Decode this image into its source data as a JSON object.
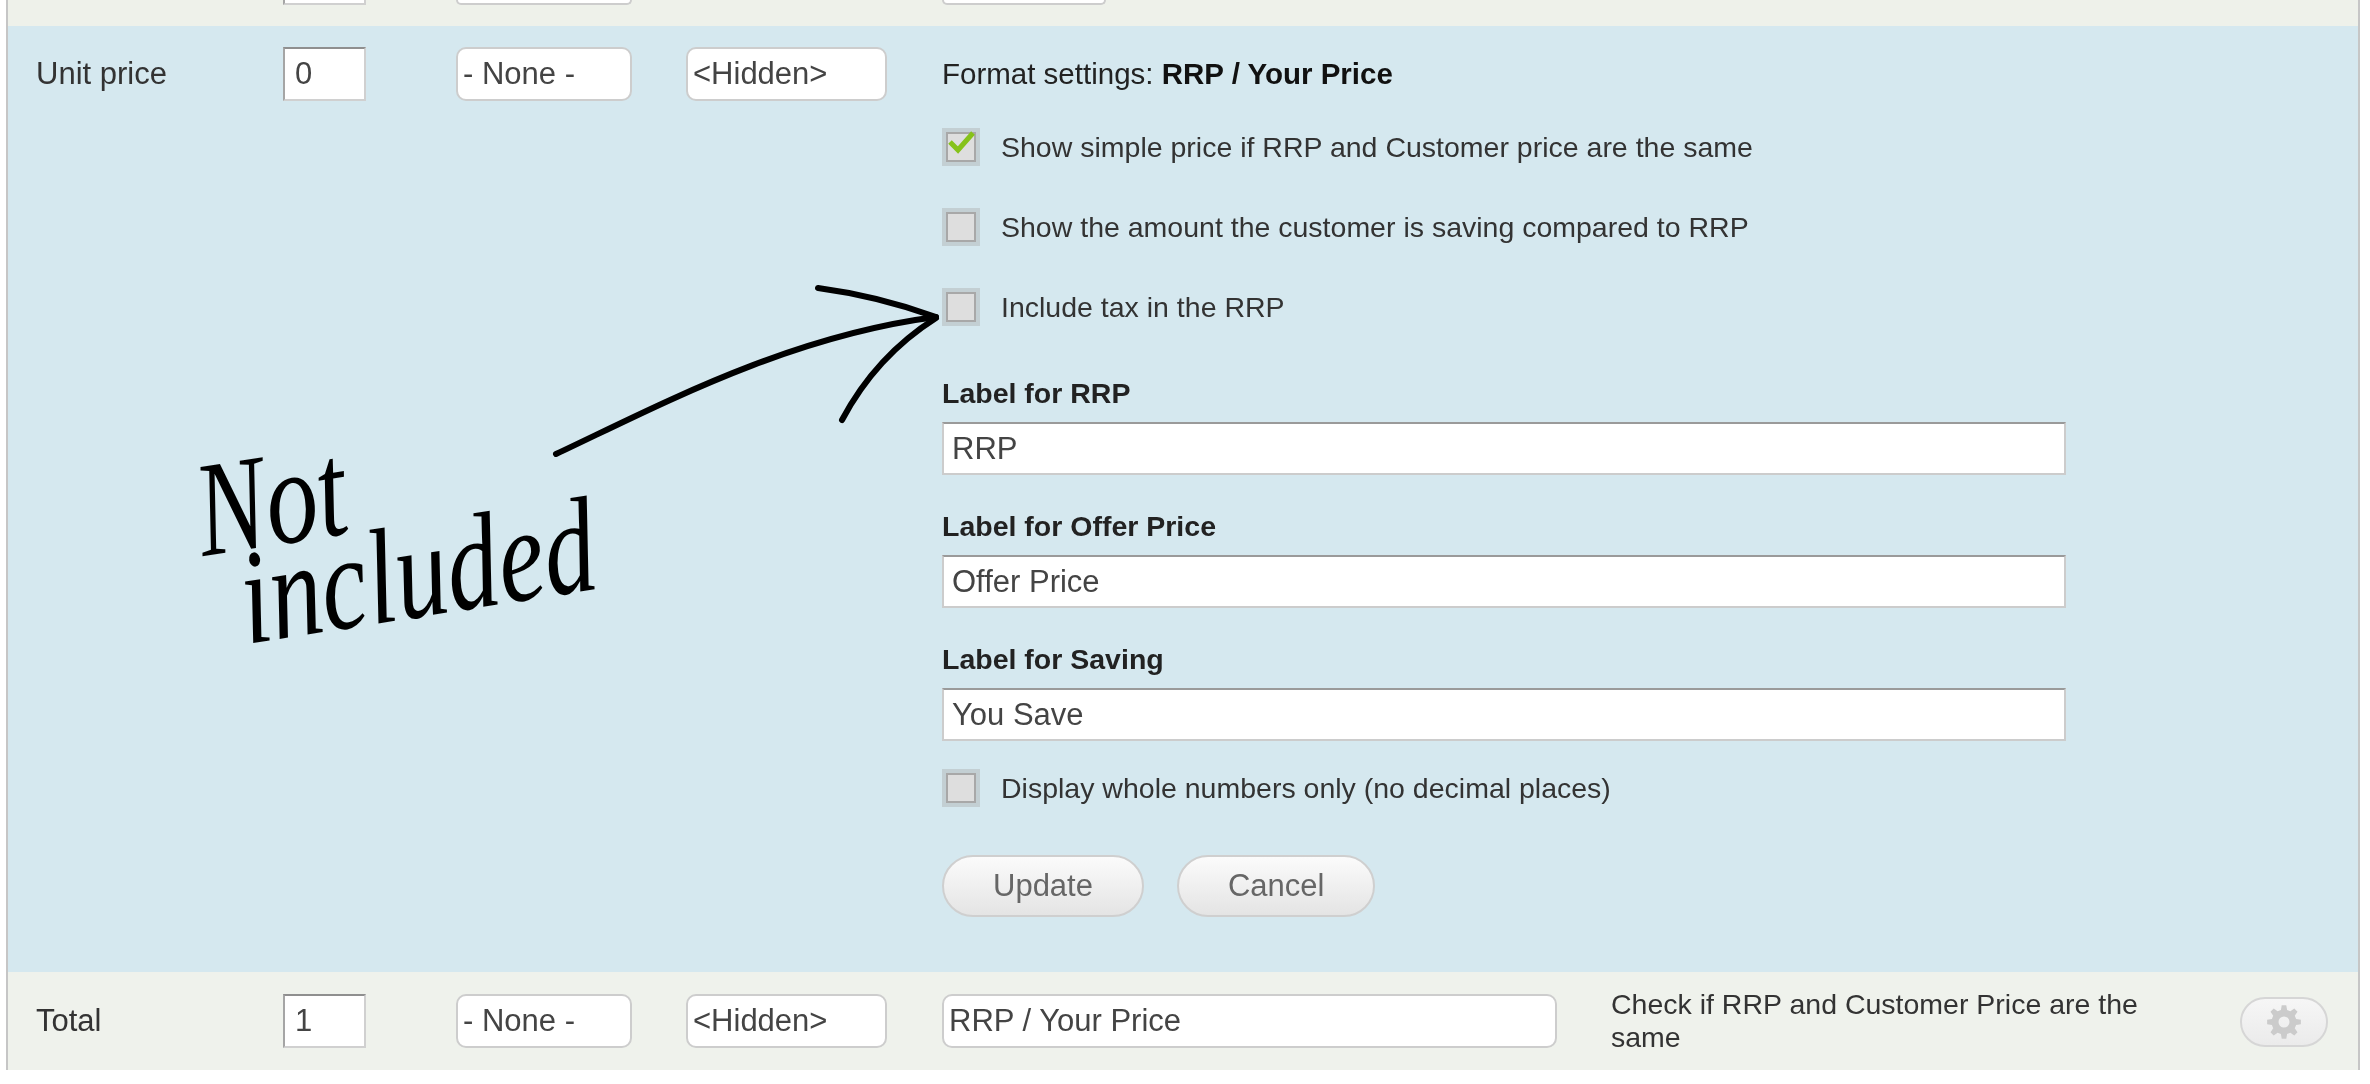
{
  "previous_row": {
    "fields": [
      {
        "kind": "number"
      },
      {
        "kind": "select"
      },
      {
        "kind": "text"
      }
    ]
  },
  "unit_price_row": {
    "label": "Unit price",
    "fields": [
      {
        "kind": "number",
        "value": "0"
      },
      {
        "kind": "select",
        "value": "- None -"
      },
      {
        "kind": "select",
        "value": "<Hidden>"
      }
    ],
    "format_settings": {
      "title": "Format settings: **RRP / Your Price**",
      "items": [
        {
          "kind": "checkbox",
          "label": "Show simple price if RRP and Customer price are the same",
          "checked": true
        },
        {
          "kind": "checkbox",
          "label": "Show the amount the customer is saving compared to RRP",
          "checked": false
        },
        {
          "kind": "checkbox",
          "label": "Include tax in the RRP",
          "checked": false
        },
        {
          "kind": "field",
          "label": "Label for RRP",
          "value": "RRP"
        },
        {
          "kind": "field",
          "label": "Label for Offer Price",
          "value": "Offer Price"
        },
        {
          "kind": "field",
          "label": "Label for Saving",
          "value": "You Save"
        },
        {
          "kind": "checkbox",
          "label": "Display whole numbers only (no decimal places)",
          "checked": false
        }
      ],
      "buttons": [
        "Update",
        "Cancel"
      ]
    }
  },
  "total_row": {
    "label": "Total",
    "fields": [
      {
        "kind": "number",
        "value": "1"
      },
      {
        "kind": "select",
        "value": "- None -"
      },
      {
        "kind": "select",
        "value": "<Hidden>"
      },
      {
        "kind": "text",
        "value": "RRP / Your Price"
      }
    ],
    "note": "Check if RRP and Customer Price are the same",
    "settings_button": {
      "disabled": true
    }
  },
  "annotation": {
    "text": "Not included"
  }
}
